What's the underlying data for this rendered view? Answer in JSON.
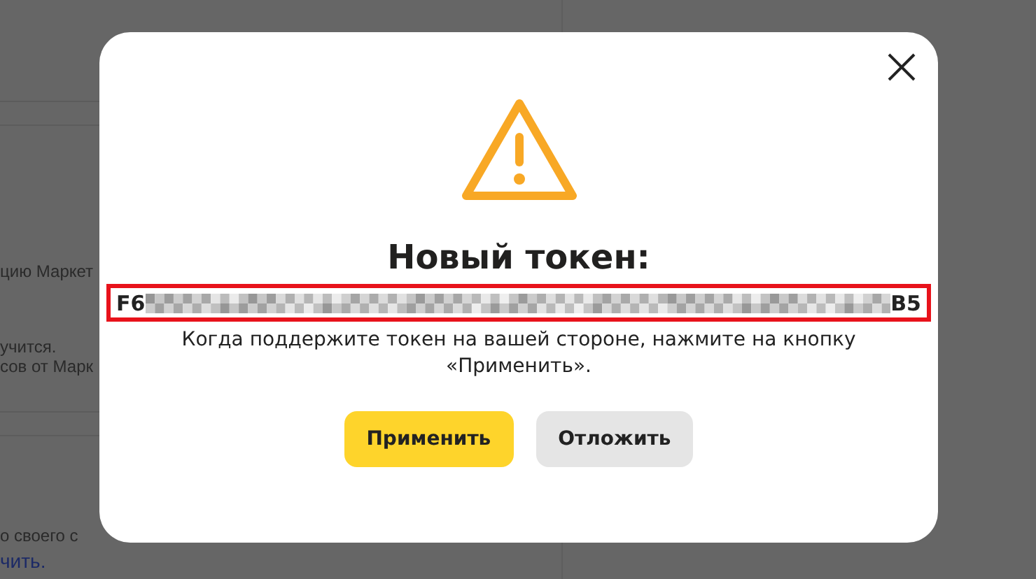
{
  "background": {
    "texts": [
      {
        "text": "цию Маркет",
        "kind": "text"
      },
      {
        "text": "учится.",
        "kind": "text"
      },
      {
        "text": "сов от Марк",
        "kind": "text"
      },
      {
        "text": "о своего с",
        "kind": "text"
      },
      {
        "text": "чить.",
        "kind": "link"
      }
    ]
  },
  "dialog": {
    "title": "Новый токен:",
    "token": {
      "start": "F6",
      "end": "B5"
    },
    "message": "Когда поддержите токен на вашей стороне, нажмите на кнопку «Применить».",
    "buttons": [
      {
        "label": "Применить",
        "kind": "primary"
      },
      {
        "label": "Отложить",
        "kind": "secondary"
      }
    ]
  }
}
